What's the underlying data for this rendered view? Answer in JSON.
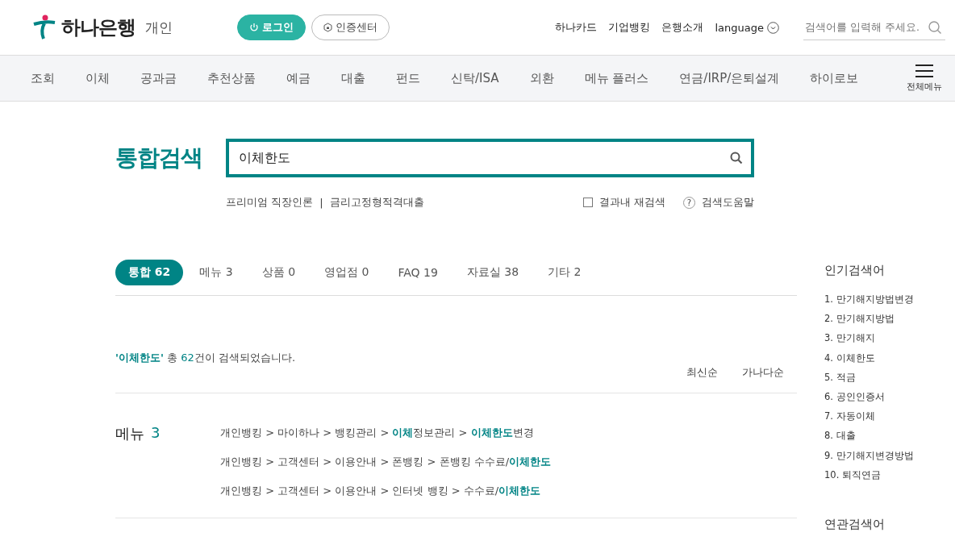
{
  "header": {
    "logo": "하나은행",
    "section": "개인",
    "login_button": "로그인",
    "cert_button": "인증센터",
    "links": [
      "하나카드",
      "기업뱅킹",
      "은행소개"
    ],
    "language": "language",
    "search_placeholder": "검색어를 입력해 주세요."
  },
  "nav": {
    "items": [
      "조회",
      "이체",
      "공과금",
      "추천상품",
      "예금",
      "대출",
      "펀드",
      "신탁/ISA",
      "외환",
      "메뉴 플러스",
      "연금/IRP/은퇴설계",
      "하이로보"
    ],
    "all_menu": "전체메뉴"
  },
  "search": {
    "title": "통합검색",
    "value": "이체한도",
    "suggestions": [
      "프리미엄 직장인론",
      "금리고정형적격대출"
    ],
    "separator": "|",
    "research": {
      "label": "결과내 재검색",
      "checked": false
    },
    "help_icon": "?",
    "help": "검색도움말"
  },
  "tabs": [
    {
      "label": "통합 62",
      "selected": true
    },
    {
      "label": "메뉴 3",
      "selected": false
    },
    {
      "label": "상품 0",
      "selected": false
    },
    {
      "label": "영업점 0",
      "selected": false
    },
    {
      "label": "FAQ 19",
      "selected": false
    },
    {
      "label": "자료실 38",
      "selected": false
    },
    {
      "label": "기타 2",
      "selected": false
    }
  ],
  "summary": {
    "query": "'이체한도'",
    "before_count": " 총 ",
    "count": "62",
    "after_count": "건이 검색되었습니다."
  },
  "sort": [
    "최신순",
    "가나다순"
  ],
  "menu_section": {
    "title": "메뉴",
    "count": "3",
    "results": [
      "개인뱅킹 > 마이하나 > 뱅킹관리 > **이체**정보관리 > **이체한도**변경",
      "개인뱅킹 > 고객센터 > 이용안내 > 폰뱅킹 > 폰뱅킹 수수료/**이체한도**",
      "개인뱅킹 > 고객센터 > 이용안내 > 인터넷 뱅킹 > 수수료/**이체한도**"
    ]
  },
  "sidebar": {
    "popular_title": "인기검색어",
    "popular": [
      "1. 만기해지방법변경",
      "2. 만기해지방법",
      "3. 만기해지",
      "4. 이체한도",
      "5. 적금",
      "6. 공인인증서",
      "7. 자동이체",
      "8. 대출",
      "9. 만기해지변경방법",
      "10. 퇴직연금"
    ],
    "related_title": "연관검색어"
  }
}
